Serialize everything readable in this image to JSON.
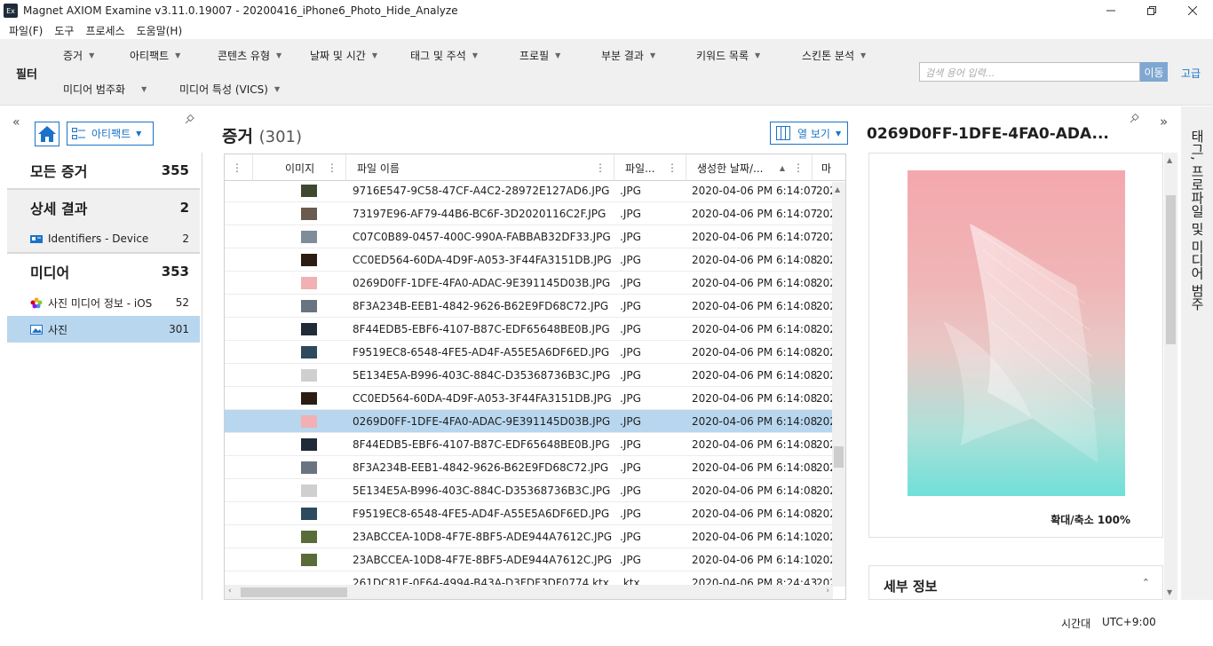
{
  "window": {
    "icon_text": "Ex",
    "title": "Magnet AXIOM Examine v3.11.0.19007 - 20200416_iPhone6_Photo_Hide_Analyze"
  },
  "menu": [
    "파일(F)",
    "도구",
    "프로세스",
    "도움말(H)"
  ],
  "filters": {
    "label": "필터",
    "row1": [
      "증거",
      "아티팩트",
      "콘텐츠 유형",
      "날짜 및 시간",
      "태그 및 주석",
      "프로필",
      "부분 결과",
      "키워드 목록",
      "스킨톤 분석"
    ],
    "row2": [
      "미디어 범주화",
      "미디어 특성 (VICS)"
    ],
    "search_placeholder": "검색 용어 입력...",
    "go_label": "이동",
    "advanced_label": "고급"
  },
  "left_panel": {
    "artifact_dropdown": "아티팩트",
    "items": [
      {
        "label": "모든 증거",
        "count": "355"
      },
      {
        "label": "상세 결과",
        "count": "2"
      },
      {
        "label": "Identifiers - Device",
        "count": "2"
      },
      {
        "label": "미디어",
        "count": "353"
      },
      {
        "label": "사진 미디어 정보 - iOS",
        "count": "52"
      },
      {
        "label": "사진",
        "count": "301"
      }
    ]
  },
  "center": {
    "title": "증거",
    "count": "(301)",
    "column_view": "열 보기",
    "columns": [
      "",
      "이미지",
      "파일 이름",
      "파일...",
      "생성한 날짜/...",
      "마"
    ],
    "rows": [
      {
        "name": "9716E547-9C58-47CF-A4C2-28972E127AD6.JPG",
        "ext": ".JPG",
        "date": "2020-04-06 PM 6:14:07",
        "extra": "202",
        "thumb": "#3d4a2f"
      },
      {
        "name": "73197E96-AF79-44B6-BC6F-3D2020116C2F.JPG",
        "ext": ".JPG",
        "date": "2020-04-06 PM 6:14:07",
        "extra": "202",
        "thumb": "#6b5b4e"
      },
      {
        "name": "C07C0B89-0457-400C-990A-FABBAB32DF33.JPG",
        "ext": ".JPG",
        "date": "2020-04-06 PM 6:14:07",
        "extra": "202",
        "thumb": "#7f8c99"
      },
      {
        "name": "CC0ED564-60DA-4D9F-A053-3F44FA3151DB.JPG",
        "ext": ".JPG",
        "date": "2020-04-06 PM 6:14:08",
        "extra": "202",
        "thumb": "#2b1d14"
      },
      {
        "name": "0269D0FF-1DFE-4FA0-ADAC-9E391145D03B.JPG",
        "ext": ".JPG",
        "date": "2020-04-06 PM 6:14:08",
        "extra": "202",
        "thumb": "#f0b0b4"
      },
      {
        "name": "8F3A234B-EEB1-4842-9626-B62E9FD68C72.JPG",
        "ext": ".JPG",
        "date": "2020-04-06 PM 6:14:08",
        "extra": "202",
        "thumb": "#6a7480"
      },
      {
        "name": "8F44EDB5-EBF6-4107-B87C-EDF65648BE0B.JPG",
        "ext": ".JPG",
        "date": "2020-04-06 PM 6:14:08",
        "extra": "202",
        "thumb": "#1f2b38"
      },
      {
        "name": "F9519EC8-6548-4FE5-AD4F-A55E5A6DF6ED.JPG",
        "ext": ".JPG",
        "date": "2020-04-06 PM 6:14:08",
        "extra": "202",
        "thumb": "#2d4a5e"
      },
      {
        "name": "5E134E5A-B996-403C-884C-D35368736B3C.JPG",
        "ext": ".JPG",
        "date": "2020-04-06 PM 6:14:08",
        "extra": "202",
        "thumb": "#cfcfcf"
      },
      {
        "name": "CC0ED564-60DA-4D9F-A053-3F44FA3151DB.JPG",
        "ext": ".JPG",
        "date": "2020-04-06 PM 6:14:08",
        "extra": "202",
        "thumb": "#2b1d14"
      },
      {
        "name": "0269D0FF-1DFE-4FA0-ADAC-9E391145D03B.JPG",
        "ext": ".JPG",
        "date": "2020-04-06 PM 6:14:08",
        "extra": "202",
        "thumb": "#f0b0b4",
        "selected": true
      },
      {
        "name": "8F44EDB5-EBF6-4107-B87C-EDF65648BE0B.JPG",
        "ext": ".JPG",
        "date": "2020-04-06 PM 6:14:08",
        "extra": "202",
        "thumb": "#1f2b38"
      },
      {
        "name": "8F3A234B-EEB1-4842-9626-B62E9FD68C72.JPG",
        "ext": ".JPG",
        "date": "2020-04-06 PM 6:14:08",
        "extra": "202",
        "thumb": "#6a7480"
      },
      {
        "name": "5E134E5A-B996-403C-884C-D35368736B3C.JPG",
        "ext": ".JPG",
        "date": "2020-04-06 PM 6:14:08",
        "extra": "202",
        "thumb": "#cfcfcf"
      },
      {
        "name": "F9519EC8-6548-4FE5-AD4F-A55E5A6DF6ED.JPG",
        "ext": ".JPG",
        "date": "2020-04-06 PM 6:14:08",
        "extra": "202",
        "thumb": "#2d4a5e"
      },
      {
        "name": "23ABCCEA-10D8-4F7E-8BF5-ADE944A7612C.JPG",
        "ext": ".JPG",
        "date": "2020-04-06 PM 6:14:10",
        "extra": "202",
        "thumb": "#5a6b3a"
      },
      {
        "name": "23ABCCEA-10D8-4F7E-8BF5-ADE944A7612C.JPG",
        "ext": ".JPG",
        "date": "2020-04-06 PM 6:14:10",
        "extra": "202",
        "thumb": "#5a6b3a"
      },
      {
        "name": "261DC81E-0F64-4994-B43A-D3FDF3DF0774.ktx",
        "ext": ".ktx",
        "date": "2020-04-06 PM 8:24:43",
        "extra": "202",
        "thumb": ""
      }
    ]
  },
  "preview": {
    "title": "0269D0FF-1DFE-4FA0-ADA...",
    "zoom": "확대/축소 100%",
    "details_label": "세부 정보",
    "side_tab": "태그, 프로파일 및 미디어 범주"
  },
  "status": {
    "timezone_label": "시간대",
    "timezone_value": "UTC+9:00"
  },
  "colors": {
    "accent": "#1a73c8",
    "selection": "#b8d6ee",
    "toolbar_bg": "#f0f0f0"
  }
}
